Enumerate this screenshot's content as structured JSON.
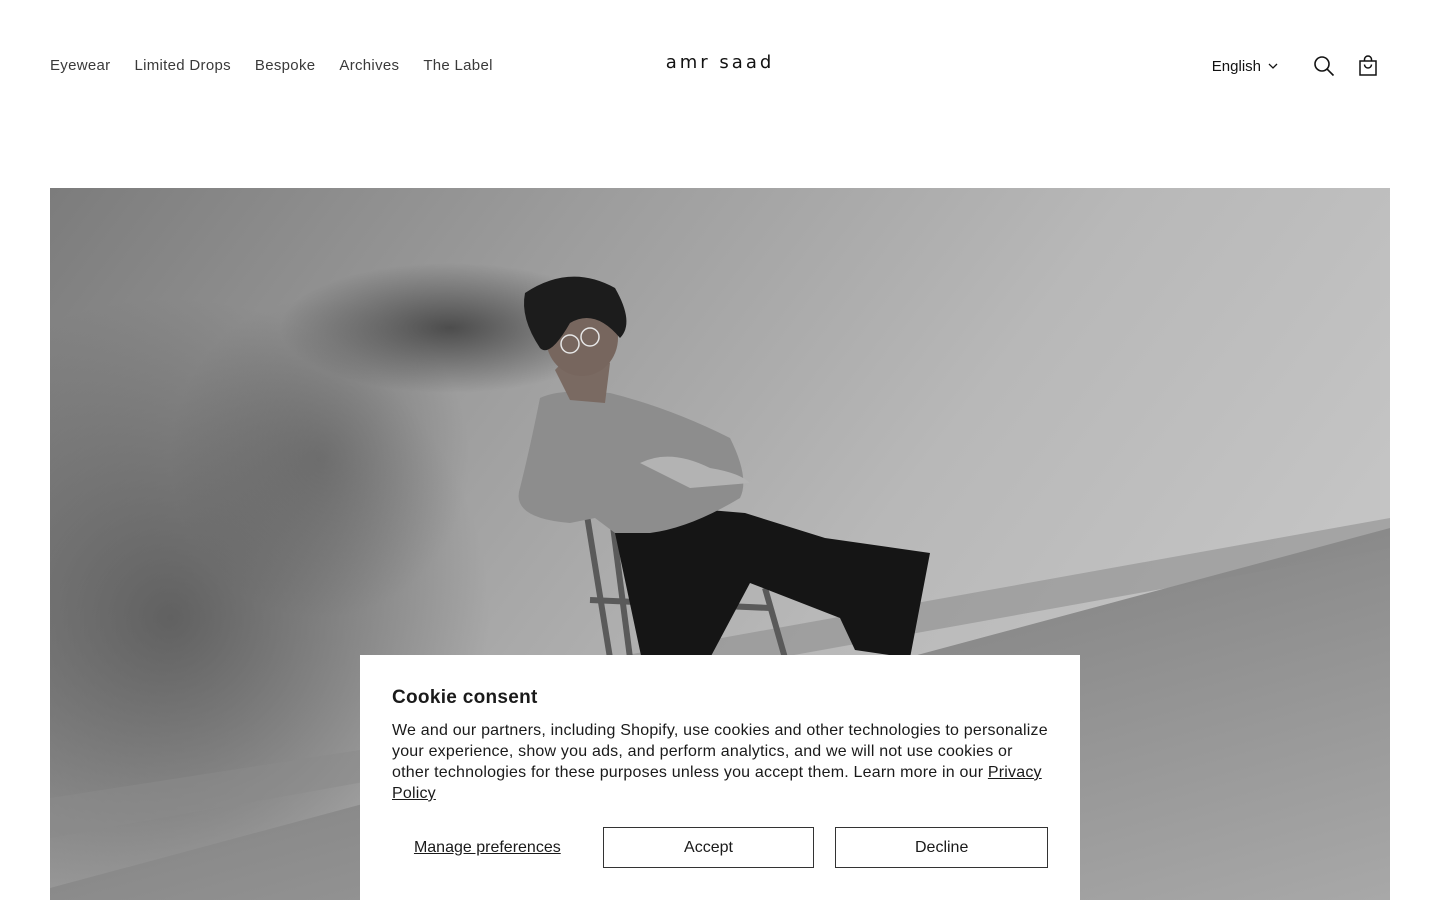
{
  "header": {
    "nav": [
      {
        "label": "Eyewear"
      },
      {
        "label": "Limited Drops"
      },
      {
        "label": "Bespoke"
      },
      {
        "label": "Archives"
      },
      {
        "label": "The Label"
      }
    ],
    "logo": "amr saad",
    "language": "English",
    "icons": {
      "language_toggle": "chevron-down-icon",
      "search": "search-icon",
      "cart": "cart-icon"
    }
  },
  "hero": {
    "image": "black-and-white photo of a man in glasses seated on a wooden chair against a concrete wall"
  },
  "cookie_banner": {
    "title": "Cookie consent",
    "body": "We and our partners, including Shopify, use cookies and other technologies to personalize your experience, show you ads, and perform analytics, and we will not use cookies or other technologies for these purposes unless you accept them. Learn more in our ",
    "privacy_link": "Privacy Policy",
    "manage_label": "Manage preferences",
    "accept_label": "Accept",
    "decline_label": "Decline"
  }
}
